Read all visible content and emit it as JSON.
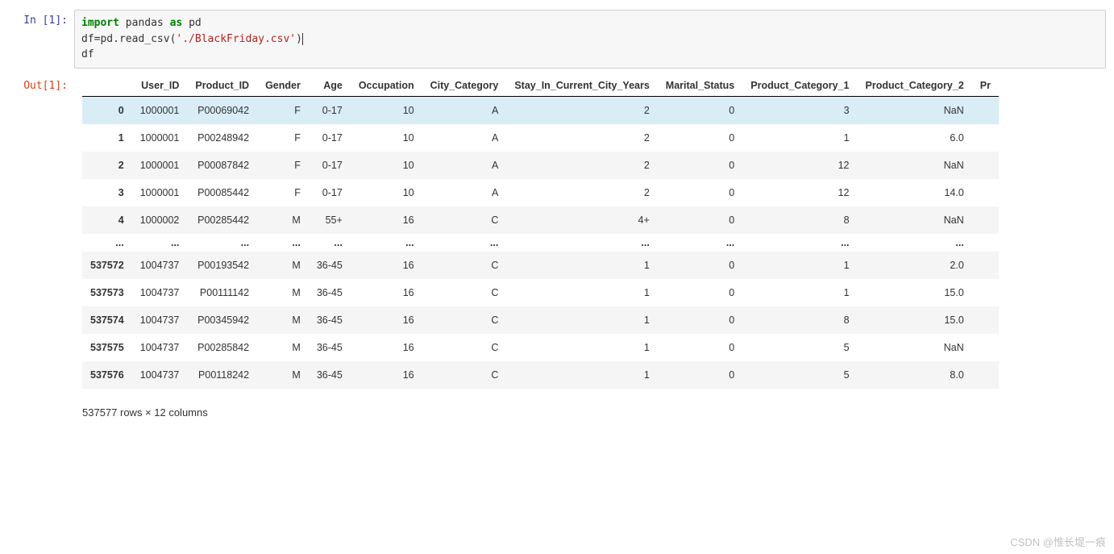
{
  "input_prompt": "In  [1]:",
  "output_prompt": "Out[1]:",
  "code": {
    "kw_import": "import",
    "pandas": " pandas ",
    "kw_as": "as",
    "pd": " pd",
    "line2a": "df=pd.read_csv(",
    "str": "'./BlackFriday.csv'",
    "line2b": ")",
    "line3": "df"
  },
  "columns": [
    "User_ID",
    "Product_ID",
    "Gender",
    "Age",
    "Occupation",
    "City_Category",
    "Stay_In_Current_City_Years",
    "Marital_Status",
    "Product_Category_1",
    "Product_Category_2",
    "Pr"
  ],
  "rows": [
    {
      "idx": "0",
      "c": [
        "1000001",
        "P00069042",
        "F",
        "0-17",
        "10",
        "A",
        "2",
        "0",
        "3",
        "NaN",
        ""
      ]
    },
    {
      "idx": "1",
      "c": [
        "1000001",
        "P00248942",
        "F",
        "0-17",
        "10",
        "A",
        "2",
        "0",
        "1",
        "6.0",
        ""
      ]
    },
    {
      "idx": "2",
      "c": [
        "1000001",
        "P00087842",
        "F",
        "0-17",
        "10",
        "A",
        "2",
        "0",
        "12",
        "NaN",
        ""
      ]
    },
    {
      "idx": "3",
      "c": [
        "1000001",
        "P00085442",
        "F",
        "0-17",
        "10",
        "A",
        "2",
        "0",
        "12",
        "14.0",
        ""
      ]
    },
    {
      "idx": "4",
      "c": [
        "1000002",
        "P00285442",
        "M",
        "55+",
        "16",
        "C",
        "4+",
        "0",
        "8",
        "NaN",
        ""
      ]
    },
    {
      "idx": "...",
      "c": [
        "...",
        "...",
        "...",
        "...",
        "...",
        "...",
        "...",
        "...",
        "...",
        "...",
        ""
      ]
    },
    {
      "idx": "537572",
      "c": [
        "1004737",
        "P00193542",
        "M",
        "36-45",
        "16",
        "C",
        "1",
        "0",
        "1",
        "2.0",
        ""
      ]
    },
    {
      "idx": "537573",
      "c": [
        "1004737",
        "P00111142",
        "M",
        "36-45",
        "16",
        "C",
        "1",
        "0",
        "1",
        "15.0",
        ""
      ]
    },
    {
      "idx": "537574",
      "c": [
        "1004737",
        "P00345942",
        "M",
        "36-45",
        "16",
        "C",
        "1",
        "0",
        "8",
        "15.0",
        ""
      ]
    },
    {
      "idx": "537575",
      "c": [
        "1004737",
        "P00285842",
        "M",
        "36-45",
        "16",
        "C",
        "1",
        "0",
        "5",
        "NaN",
        ""
      ]
    },
    {
      "idx": "537576",
      "c": [
        "1004737",
        "P00118242",
        "M",
        "36-45",
        "16",
        "C",
        "1",
        "0",
        "5",
        "8.0",
        ""
      ]
    }
  ],
  "shape_text": "537577 rows × 12 columns",
  "watermark": "CSDN @惟长堤一痕",
  "chart_data": {
    "type": "table",
    "title": "BlackFriday.csv DataFrame preview",
    "columns": [
      "User_ID",
      "Product_ID",
      "Gender",
      "Age",
      "Occupation",
      "City_Category",
      "Stay_In_Current_City_Years",
      "Marital_Status",
      "Product_Category_1",
      "Product_Category_2"
    ],
    "n_rows": 537577,
    "n_cols": 12,
    "head": [
      {
        "index": 0,
        "User_ID": 1000001,
        "Product_ID": "P00069042",
        "Gender": "F",
        "Age": "0-17",
        "Occupation": 10,
        "City_Category": "A",
        "Stay_In_Current_City_Years": "2",
        "Marital_Status": 0,
        "Product_Category_1": 3,
        "Product_Category_2": null
      },
      {
        "index": 1,
        "User_ID": 1000001,
        "Product_ID": "P00248942",
        "Gender": "F",
        "Age": "0-17",
        "Occupation": 10,
        "City_Category": "A",
        "Stay_In_Current_City_Years": "2",
        "Marital_Status": 0,
        "Product_Category_1": 1,
        "Product_Category_2": 6.0
      },
      {
        "index": 2,
        "User_ID": 1000001,
        "Product_ID": "P00087842",
        "Gender": "F",
        "Age": "0-17",
        "Occupation": 10,
        "City_Category": "A",
        "Stay_In_Current_City_Years": "2",
        "Marital_Status": 0,
        "Product_Category_1": 12,
        "Product_Category_2": null
      },
      {
        "index": 3,
        "User_ID": 1000001,
        "Product_ID": "P00085442",
        "Gender": "F",
        "Age": "0-17",
        "Occupation": 10,
        "City_Category": "A",
        "Stay_In_Current_City_Years": "2",
        "Marital_Status": 0,
        "Product_Category_1": 12,
        "Product_Category_2": 14.0
      },
      {
        "index": 4,
        "User_ID": 1000002,
        "Product_ID": "P00285442",
        "Gender": "M",
        "Age": "55+",
        "Occupation": 16,
        "City_Category": "C",
        "Stay_In_Current_City_Years": "4+",
        "Marital_Status": 0,
        "Product_Category_1": 8,
        "Product_Category_2": null
      }
    ],
    "tail": [
      {
        "index": 537572,
        "User_ID": 1004737,
        "Product_ID": "P00193542",
        "Gender": "M",
        "Age": "36-45",
        "Occupation": 16,
        "City_Category": "C",
        "Stay_In_Current_City_Years": "1",
        "Marital_Status": 0,
        "Product_Category_1": 1,
        "Product_Category_2": 2.0
      },
      {
        "index": 537573,
        "User_ID": 1004737,
        "Product_ID": "P00111142",
        "Gender": "M",
        "Age": "36-45",
        "Occupation": 16,
        "City_Category": "C",
        "Stay_In_Current_City_Years": "1",
        "Marital_Status": 0,
        "Product_Category_1": 1,
        "Product_Category_2": 15.0
      },
      {
        "index": 537574,
        "User_ID": 1004737,
        "Product_ID": "P00345942",
        "Gender": "M",
        "Age": "36-45",
        "Occupation": 16,
        "City_Category": "C",
        "Stay_In_Current_City_Years": "1",
        "Marital_Status": 0,
        "Product_Category_1": 8,
        "Product_Category_2": 15.0
      },
      {
        "index": 537575,
        "User_ID": 1004737,
        "Product_ID": "P00285842",
        "Gender": "M",
        "Age": "36-45",
        "Occupation": 16,
        "City_Category": "C",
        "Stay_In_Current_City_Years": "1",
        "Marital_Status": 0,
        "Product_Category_1": 5,
        "Product_Category_2": null
      },
      {
        "index": 537576,
        "User_ID": 1004737,
        "Product_ID": "P00118242",
        "Gender": "M",
        "Age": "36-45",
        "Occupation": 16,
        "City_Category": "C",
        "Stay_In_Current_City_Years": "1",
        "Marital_Status": 0,
        "Product_Category_1": 5,
        "Product_Category_2": 8.0
      }
    ]
  }
}
